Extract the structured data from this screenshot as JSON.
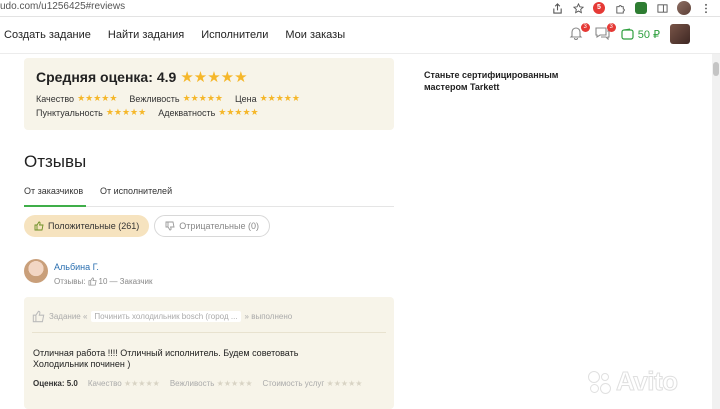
{
  "browser": {
    "url": "udo.com/u1256425#reviews",
    "ext_badge": "5"
  },
  "nav": {
    "links": [
      "Создать задание",
      "Найти задания",
      "Исполнители",
      "Мои заказы"
    ],
    "notif_count": "3",
    "msg_count": "3",
    "balance": "50 ₽"
  },
  "rating": {
    "title": "Средняя оценка:",
    "value": "4.9",
    "criteria_row1": [
      "Качество",
      "Вежливость",
      "Цена"
    ],
    "criteria_row2": [
      "Пунктуальность",
      "Адекватность"
    ]
  },
  "sidebar": {
    "cta": "Станьте сертифицированным мастером Tarkett"
  },
  "reviews": {
    "title": "Отзывы",
    "tabs": [
      "От заказчиков",
      "От исполнителей"
    ],
    "filter_positive": "Положительные (261)",
    "filter_negative": "Отрицательные (0)"
  },
  "review": {
    "author": "Альбина Г.",
    "meta_prefix": "Отзывы:",
    "meta_count": "10",
    "meta_role": "— Заказчик",
    "task_prefix": "Задание «",
    "task_name": "Починить холодильник bosch (город ...",
    "task_suffix": "» выполнено",
    "text_line1": "Отличная работа !!!! Отличный исполнитель. Будем советовать",
    "text_line2": "Холодильник починен )",
    "score_label": "Оценка: 5.0",
    "crit": [
      "Качество",
      "Вежливость",
      "Стоимость услуг"
    ]
  },
  "watermark": "Avito",
  "colors": {
    "accent_green": "#3fae49",
    "star": "#f5b72a",
    "link_blue": "#2a6fb0",
    "card_bg": "#f7f4e9"
  }
}
